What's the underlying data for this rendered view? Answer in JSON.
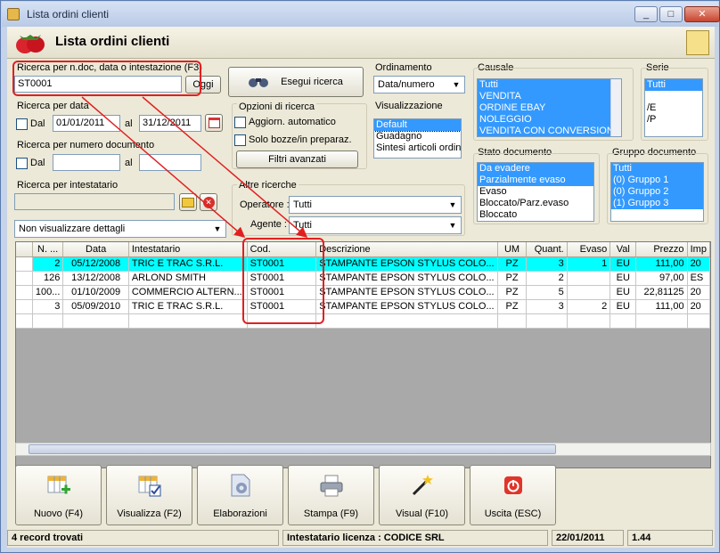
{
  "window": {
    "title": "Lista ordini clienti",
    "minimize": "_",
    "maximize": "□",
    "close": "✕"
  },
  "header": {
    "title": "Lista ordini clienti"
  },
  "search": {
    "label": "Ricerca per n.doc, data o intestazione (F3)",
    "value": "ST0001",
    "today_button": "Oggi",
    "run_button": "Esegui ricerca"
  },
  "date_search": {
    "label": "Ricerca per data",
    "from_label": "Dal",
    "from": "01/01/2011",
    "to_label": "al",
    "to": "31/12/2011"
  },
  "number_search": {
    "label": "Ricerca per numero documento",
    "from_label": "Dal",
    "from": "",
    "to_label": "al",
    "to": ""
  },
  "holder_search": {
    "label": "Ricerca per intestatario",
    "value": ""
  },
  "details_select": {
    "value": "Non visualizzare dettagli"
  },
  "options": {
    "label": "Opzioni di ricerca",
    "auto_update": "Aggiorn. automatico",
    "drafts_only": "Solo bozze/in preparaz.",
    "advanced_filters": "Filtri avanzati"
  },
  "other_searches": {
    "label": "Altre ricerche",
    "operator_label": "Operatore :",
    "operator": "Tutti",
    "agent_label": "Agente :",
    "agent": "Tutti"
  },
  "ordering": {
    "label": "Ordinamento",
    "value": "Data/numero"
  },
  "view": {
    "label": "Visualizzazione",
    "items": [
      "Default",
      "Guadagno",
      "Sintesi articoli ordina"
    ]
  },
  "causale": {
    "label": "Causale",
    "items": [
      "Tutti",
      "VENDITA",
      "ORDINE EBAY",
      "NOLEGGIO",
      "VENDITA CON CONVERSIONE"
    ]
  },
  "serie": {
    "label": "Serie",
    "items": [
      "Tutti",
      "",
      "/E",
      "/P"
    ]
  },
  "doc_state": {
    "label": "Stato documento",
    "items": [
      "Da evadere",
      "Parzialmente evaso",
      "Evaso",
      "Bloccato/Parz.evaso",
      "Bloccato"
    ]
  },
  "doc_group": {
    "label": "Gruppo documento",
    "items": [
      "Tutti",
      "(0) Gruppo 1",
      "(0) Gruppo 2",
      "(1) Gruppo 3"
    ]
  },
  "table": {
    "columns": [
      "N. ...",
      "Data",
      "Intestatario",
      "Cod.",
      "Descrizione",
      "UM",
      "Quant.",
      "Evaso",
      "Val",
      "Prezzo",
      "Imp"
    ],
    "rows": [
      [
        "2",
        "05/12/2008",
        "TRIC E TRAC S.R.L.",
        "ST0001",
        "STAMPANTE EPSON STYLUS COLO...",
        "PZ",
        "3",
        "1",
        "EU",
        "111,00",
        "20"
      ],
      [
        "126",
        "13/12/2008",
        "ARLOND SMITH",
        "ST0001",
        "STAMPANTE EPSON STYLUS COLO...",
        "PZ",
        "2",
        "",
        "EU",
        "97,00",
        "ES"
      ],
      [
        "100...",
        "01/10/2009",
        "COMMERCIO ALTERN...",
        "ST0001",
        "STAMPANTE EPSON STYLUS COLO...",
        "PZ",
        "5",
        "",
        "EU",
        "22,81125",
        "20"
      ],
      [
        "3",
        "05/09/2010",
        "TRIC E TRAC S.R.L.",
        "ST0001",
        "STAMPANTE EPSON STYLUS COLO...",
        "PZ",
        "3",
        "2",
        "EU",
        "111,00",
        "20"
      ]
    ]
  },
  "toolbar": {
    "new": "Nuovo (F4)",
    "view": "Visualizza (F2)",
    "process": "Elaborazioni",
    "print": "Stampa (F9)",
    "visual": "Visual (F10)",
    "exit": "Uscita (ESC)"
  },
  "status": {
    "records": "4 record trovati",
    "license": "Intestatario licenza : CODICE SRL",
    "date": "22/01/2011",
    "version": "1.44"
  },
  "colors": {
    "highlight": "#00ffff",
    "selection": "#3399ff",
    "callout": "#e02020"
  }
}
